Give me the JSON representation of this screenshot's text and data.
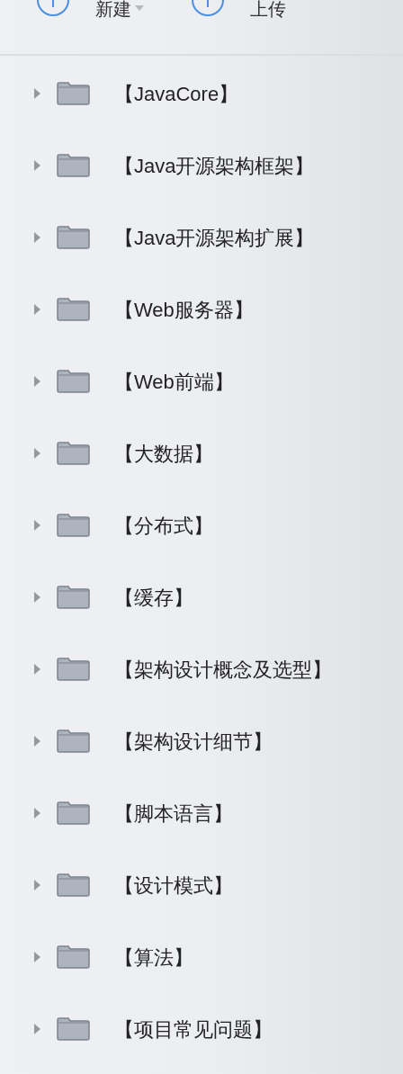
{
  "toolbar": {
    "buttons": [
      {
        "label": "新建",
        "has_menu": true
      },
      {
        "label": "上传",
        "has_menu": false
      }
    ]
  },
  "folders": [
    {
      "name": "【JavaCore】",
      "expanded": false
    },
    {
      "name": "【Java开源架构框架】",
      "expanded": false
    },
    {
      "name": "【Java开源架构扩展】",
      "expanded": false
    },
    {
      "name": "【Web服务器】",
      "expanded": false
    },
    {
      "name": "【Web前端】",
      "expanded": false
    },
    {
      "name": "【大数据】",
      "expanded": false
    },
    {
      "name": "【分布式】",
      "expanded": false
    },
    {
      "name": "【缓存】",
      "expanded": false
    },
    {
      "name": "【架构设计概念及选型】",
      "expanded": false
    },
    {
      "name": "【架构设计细节】",
      "expanded": false
    },
    {
      "name": "【脚本语言】",
      "expanded": false
    },
    {
      "name": "【设计模式】",
      "expanded": false
    },
    {
      "name": "【算法】",
      "expanded": false
    },
    {
      "name": "【项目常见问题】",
      "expanded": false
    }
  ]
}
